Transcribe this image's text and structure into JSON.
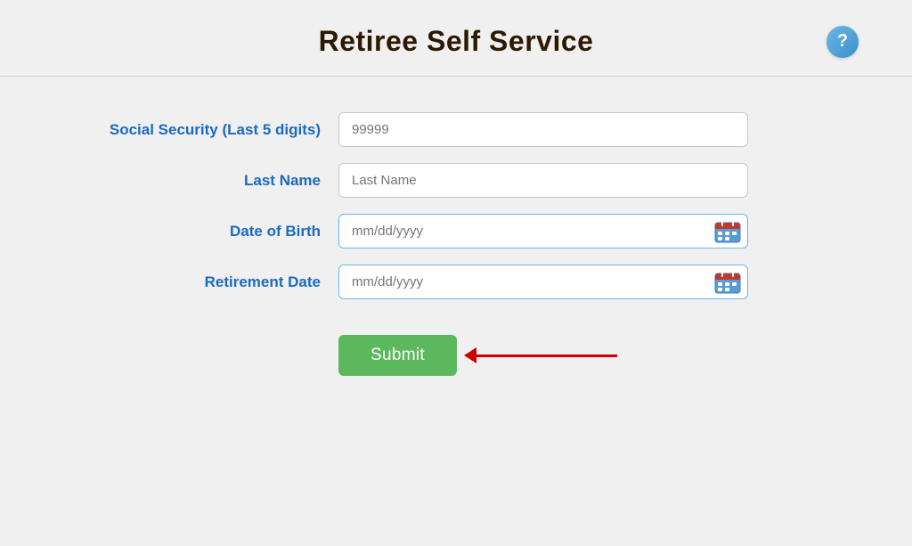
{
  "header": {
    "title": "Retiree Self Service",
    "help_icon": "?"
  },
  "form": {
    "fields": [
      {
        "label": "Social Security (Last 5 digits)",
        "placeholder": "99999",
        "type": "text",
        "name": "social-security-input"
      },
      {
        "label": "Last Name",
        "placeholder": "Last Name",
        "type": "text",
        "name": "last-name-input"
      },
      {
        "label": "Date of Birth",
        "placeholder": "mm/dd/yyyy",
        "type": "date",
        "name": "date-of-birth-input"
      },
      {
        "label": "Retirement Date",
        "placeholder": "mm/dd/yyyy",
        "type": "date",
        "name": "retirement-date-input"
      }
    ],
    "submit_label": "Submit"
  },
  "colors": {
    "label": "#1a6bbf",
    "title": "#2c1a00",
    "submit_bg": "#5cb85c",
    "arrow": "#cc0000",
    "date_border": "#6bb8e8"
  }
}
